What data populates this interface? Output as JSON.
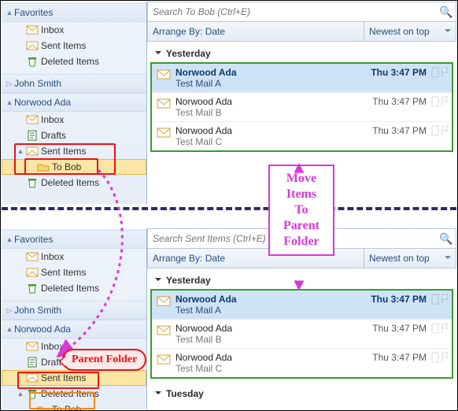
{
  "top": {
    "nav": {
      "favorites": "Favorites",
      "fav_items": [
        "Inbox",
        "Sent Items",
        "Deleted Items"
      ],
      "acct1": "John Smith",
      "acct2": "Norwood Ada",
      "acct2_items": [
        "Inbox",
        "Drafts",
        "Sent Items",
        "To Bob",
        "Deleted Items"
      ]
    },
    "search_placeholder": "Search To Bob (Ctrl+E)",
    "arrange_by": "Arrange By: Date",
    "arrange_right": "Newest on top",
    "group1": "Yesterday",
    "messages": [
      {
        "from": "Norwood Ada",
        "subj": "Test Mail A",
        "time": "Thu 3:47 PM",
        "sel": true
      },
      {
        "from": "Norwood Ada",
        "subj": "Test Mail B",
        "time": "Thu 3:47 PM",
        "sel": false
      },
      {
        "from": "Norwood Ada",
        "subj": "Test Mail C",
        "time": "Thu 3:47 PM",
        "sel": false
      }
    ]
  },
  "bot": {
    "nav": {
      "favorites": "Favorites",
      "fav_items": [
        "Inbox",
        "Sent Items",
        "Deleted Items"
      ],
      "acct1": "John Smith",
      "acct2": "Norwood Ada",
      "acct2_items": [
        "Inbox",
        "Drafts",
        "Sent Items",
        "Deleted Items",
        "To Bob"
      ]
    },
    "search_placeholder": "Search Sent Items (Ctrl+E)",
    "arrange_by": "Arrange By: Date",
    "arrange_right": "Newest on top",
    "group1": "Yesterday",
    "group2": "Tuesday",
    "messages": [
      {
        "from": "Norwood Ada",
        "subj": "Test Mail A",
        "time": "Thu 3:47 PM",
        "sel": true
      },
      {
        "from": "Norwood Ada",
        "subj": "Test Mail B",
        "time": "Thu 3:47 PM",
        "sel": false
      },
      {
        "from": "Norwood Ada",
        "subj": "Test Mail C",
        "time": "Thu 3:47 PM",
        "sel": false
      }
    ]
  },
  "annot": {
    "move": "Move\nItems\nTo\nParent\nFolder",
    "parent": "Parent Folder"
  }
}
